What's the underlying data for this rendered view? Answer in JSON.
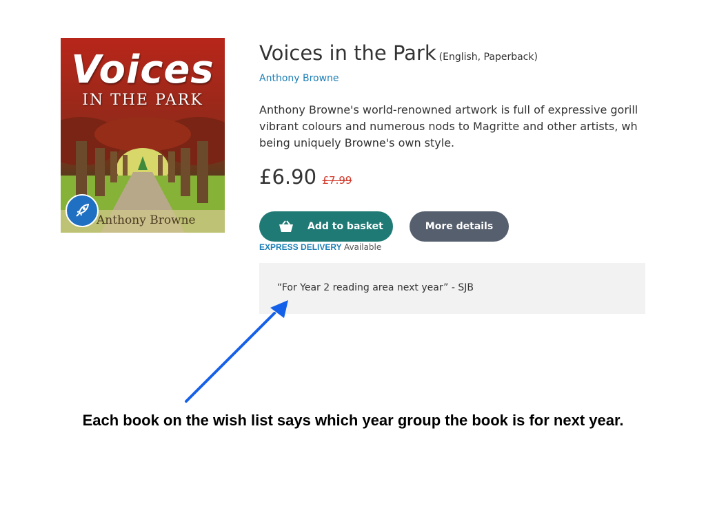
{
  "book": {
    "cover": {
      "title": "Voices",
      "subtitle": "IN THE PARK",
      "author": "Anthony Browne",
      "badge_icon": "rocket-icon"
    },
    "title": "Voices in the Park",
    "format": "(English, Paperback)",
    "author": "Anthony Browne",
    "description_lines": [
      "Anthony Browne's world-renowned artwork is full of expressive gorill",
      "vibrant colours and numerous nods to Magritte and other artists, wh",
      "being uniquely Browne's own style."
    ],
    "price": "£6.90",
    "old_price": "£7.99"
  },
  "actions": {
    "add_to_basket": "Add to basket",
    "add_to_basket_icon": "basket-icon",
    "more_details": "More details"
  },
  "delivery": {
    "express": "EXPRESS DELIVERY",
    "availability": "Available"
  },
  "note": "“For Year 2 reading area next year” - SJB",
  "caption": "Each book on the wish list says which year group the book is for next year.",
  "colors": {
    "link": "#1d7fb6",
    "basket_button": "#1f7a75",
    "details_button": "#565f6d",
    "old_price": "#d33a2c",
    "note_bg": "#f2f2f2",
    "arrow": "#1560e8"
  }
}
